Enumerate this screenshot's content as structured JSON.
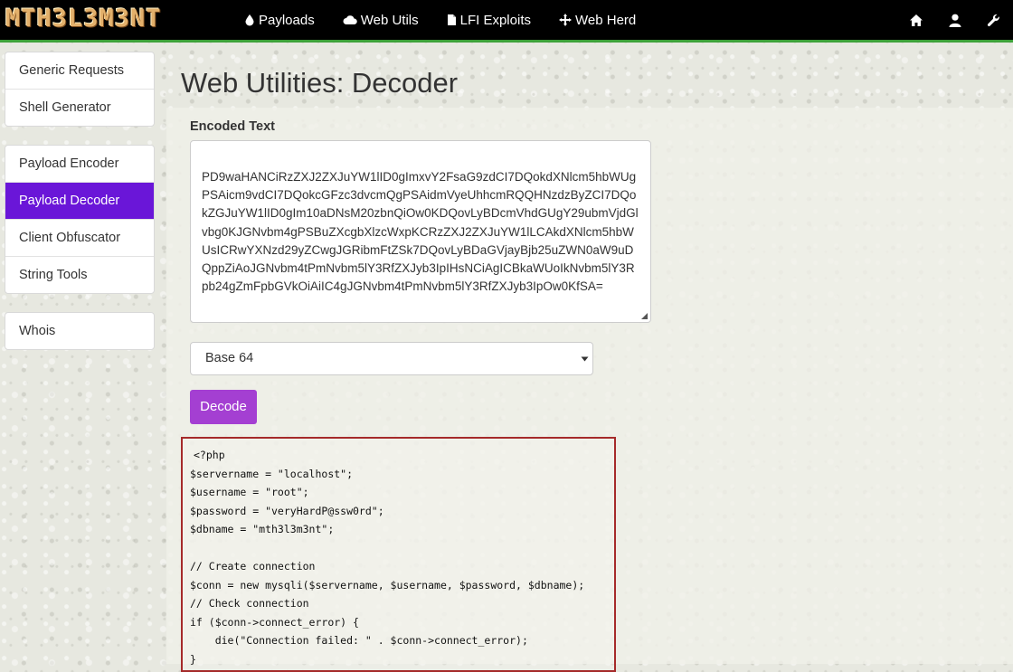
{
  "navbar": {
    "brand": "MTH3L3M3NT",
    "links": [
      {
        "label": "Payloads",
        "icon": "drop-icon"
      },
      {
        "label": "Web Utils",
        "icon": "cloud-icon"
      },
      {
        "label": "LFI Exploits",
        "icon": "file-icon"
      },
      {
        "label": "Web Herd",
        "icon": "crosshair-icon"
      }
    ],
    "right_icons": [
      "home-icon",
      "user-icon",
      "wrench-icon"
    ],
    "accent_color": "#3ea23a"
  },
  "sidebar": {
    "group1": [
      "Generic Requests",
      "Shell Generator"
    ],
    "group2": [
      "Payload Encoder",
      "Payload Decoder",
      "Client Obfuscator",
      "String Tools"
    ],
    "group3": [
      "Whois"
    ],
    "active_item": "Payload Decoder",
    "active_color": "#6a16d8"
  },
  "main": {
    "title": "Web Utilities: Decoder",
    "encoded_label": "Encoded Text",
    "encoded_text": "PD9waHANCiRzZXJ2ZXJuYW1lID0gImxvY2FsaG9zdCI7DQokdXNlcm5hbWUgPSAicm9vdCI7DQokcGFzc3dvcmQgPSAidmVyeUhhcmRQQHNzdzByZCI7DQokZGJuYW1lID0gIm10aDNsM20zbnQiOw0KDQovLyBDcmVhdGUgY29ubmVjdGlvbg0KJGNvbm4gPSBuZXcgbXlzcWxpKCRzZXJ2ZXJuYW1lLCAkdXNlcm5hbWUsICRwYXNzd29yZCwgJGRibmFtZSk7DQovLyBDaGVjayBjb25uZWN0aW9uDQppZiAoJGNvbm4tPmNvbm5lY3RfZXJyb3IpIHsNCiAgICBkaWUoIkNvbm5lY3Rpb24gZmFpbGVkOiAiIC4gJGNvbm4tPmNvbm5lY3RfZXJyb3IpOw0KfSA=",
    "select_value": "Base 64",
    "decode_label": "Decode",
    "decode_color": "#a43fd2",
    "output_border_color": "#a52a2a",
    "output_lines": [
      "<?php",
      "$servername = \"localhost\";",
      "$username = \"root\";",
      "$password = \"veryHardP@ssw0rd\";",
      "$dbname = \"mth3l3m3nt\";",
      "",
      "// Create connection",
      "$conn = new mysqli($servername, $username, $password, $dbname);",
      "// Check connection",
      "if ($conn->connect_error) {",
      "    die(\"Connection failed: \" . $conn->connect_error);",
      "}"
    ]
  }
}
